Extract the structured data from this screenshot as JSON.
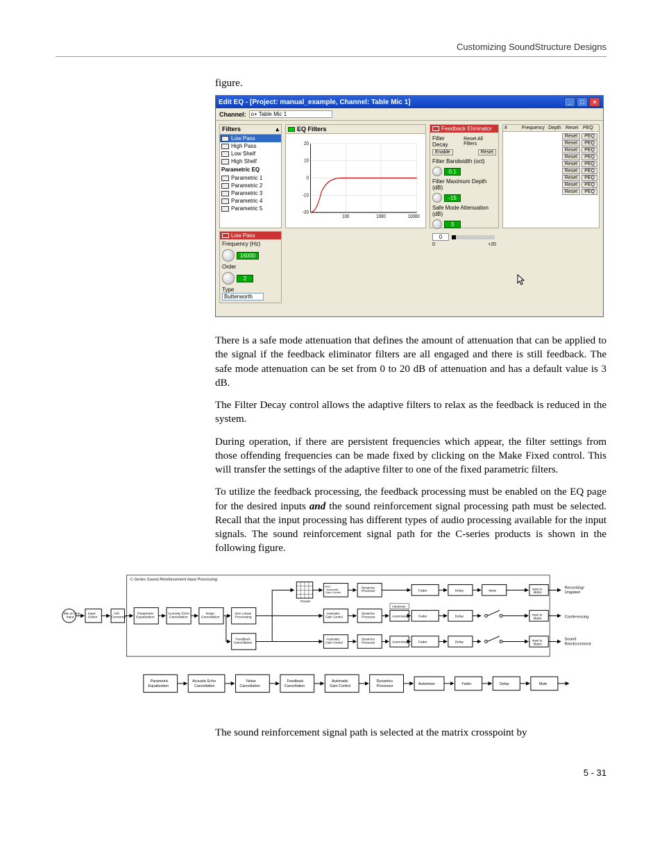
{
  "page": {
    "header": "Customizing SoundStructure Designs",
    "figure_label": "figure.",
    "footer": "5 - 31"
  },
  "screenshot": {
    "title": "Edit EQ - [Project: manual_example, Channel: Table Mic 1]",
    "channel_label": "Channel:",
    "channel_value": "o+  Table Mic 1",
    "filters_header": "Filters",
    "filters": [
      {
        "label": "Low Pass",
        "selected": true
      },
      {
        "label": "High Pass"
      },
      {
        "label": "Low Shelf"
      },
      {
        "label": "High Shelf"
      },
      {
        "label": "Parametric EQ",
        "group": true
      },
      {
        "label": "Parametric 1"
      },
      {
        "label": "Parametric 2"
      },
      {
        "label": "Parametric 3"
      },
      {
        "label": "Parametric 4"
      },
      {
        "label": "Parametric 5"
      }
    ],
    "graph_header": "EQ Filters",
    "graph_y": [
      "20",
      "10",
      "0",
      "-10",
      "-20"
    ],
    "graph_x": [
      "100",
      "1000",
      "10000"
    ],
    "fb": {
      "title": "Feedback Eliminator",
      "filter_decay_label": "Filter Decay",
      "reset_all_label": "Reset All Filters",
      "enable_label": "Enable",
      "reset_label": "Reset",
      "bandwidth_label": "Filter Bandwidth (oct)",
      "bandwidth_value": "0.1",
      "maxdepth_label": "Filter Maximum Depth (dB)",
      "maxdepth_value": "-15",
      "safemode_label": "Safe Mode Attenuation (dB)",
      "safemode_value": "3",
      "meter_low": "0",
      "meter_high": "+20",
      "meter_val": "0"
    },
    "right": {
      "cols": [
        "#",
        "Frequency",
        "Depth",
        "Reset",
        "PEQ"
      ],
      "reset": "Reset",
      "peq": "PEQ",
      "rows": 9
    },
    "lowpass": {
      "title": "Low Pass",
      "freq_label": "Frequency (Hz)",
      "freq_value": "16000",
      "order_label": "Order",
      "order_value": "2",
      "type_label": "Type",
      "type_value": "Butterworth"
    }
  },
  "paras": {
    "p1": "There is a safe mode attenuation that defines the amount of attenuation that can be applied to the signal if the feedback eliminator filters are all engaged and there is still feedback. The safe mode attenuation can be set from 0 to 20 dB of attenuation and has a default value is 3 dB.",
    "p2": "The Filter Decay control allows the adaptive filters to relax as the feedback is reduced in the system.",
    "p3": "During operation, if there are persistent frequencies which appear, the filter settings from those offending frequencies can be made fixed by clicking on the Make Fixed control. This will transfer the settings of the adaptive filter to one of the fixed parametric filters.",
    "p4a": "To utilize the feedback processing, the feedback processing must be enabled on the EQ page for the desired inputs ",
    "p4b": "and",
    "p4c": " the sound reinforcement signal processing path must be selected. Recall that the input processing has different types of audio processing available for the input signals. The sound reinforcement signal path for the C-series products is shown in the following figure.",
    "p5": "The sound reinforcement signal path is selected at the matrix crosspoint by"
  },
  "diagram": {
    "group_label": "C-Series Sound Reinforcement Input Processing",
    "input_label": "Mic or Line Input",
    "select_label": "Input Select",
    "ad_label": "A/D Converter",
    "small_blocks": {
      "pe": "Parametric Equalization",
      "aec": "Acoustic Echo Cancellation",
      "nc": "Noise Cancellation",
      "nlp": "Non Linear Processing",
      "fbc": "Feedback Cancellation",
      "agc": "AGC",
      "agc_full": "Automatic Gain Control",
      "dp": "Dynamics Processor",
      "router": "Router",
      "automixer": "Automixer",
      "fader": "Fader",
      "delay": "Delay",
      "mute": "Mute",
      "input_matrix": "Input to Matrix"
    },
    "rec_label": "Recording/Ungated",
    "conf_label": "Conferencing",
    "sr_label": "Sound Reinforcement",
    "bottom": [
      "Parametric Equalization",
      "Acoustic Echo Cancellation",
      "Noise Cancellation",
      "Feedback Cancellation",
      "Automatic Gain Control",
      "Dynamics Processor",
      "Automixer",
      "Fader",
      "Delay",
      "Mute"
    ]
  }
}
